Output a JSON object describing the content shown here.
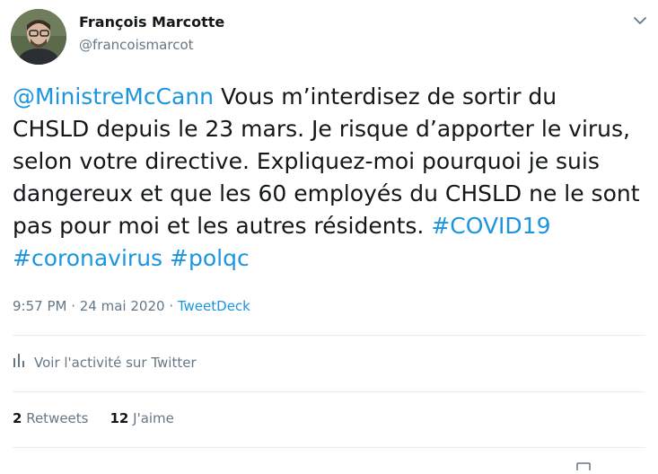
{
  "author": {
    "name": "François Marcotte",
    "handle": "@francoismarcot"
  },
  "tweet": {
    "line1_mention": "@MinistreMcCann",
    "line1_rest": " Vous m’interdisez de sortir du",
    "line2": "CHSLD depuis le 23 mars. Je risque d’apporter le virus,",
    "line3": "selon votre directive. Expliquez-moi pourquoi je suis",
    "line4": "dangereux et que les 60 employés du CHSLD ne le sont",
    "line5_text": "pas pour moi et les autres résidents. ",
    "line5_hashtag": "#COVID19",
    "line6_hashtag1": "#coronavirus",
    "line6_hashtag2": "#polqc"
  },
  "meta": {
    "time": "9:57 PM",
    "separator1": " · ",
    "date": "24 mai 2020",
    "separator2": " · ",
    "source": "TweetDeck"
  },
  "activity": {
    "label": "Voir l'activité sur Twitter",
    "icon": "bar-chart-icon"
  },
  "stats": {
    "retweets_count": "2",
    "retweets_label": " Retweets",
    "likes_count": "12",
    "likes_label": " J'aime"
  },
  "colors": {
    "link": "#1b95e0",
    "secondary_text": "#657786",
    "primary_text": "#14171a",
    "divider": "#e6ecf0"
  }
}
